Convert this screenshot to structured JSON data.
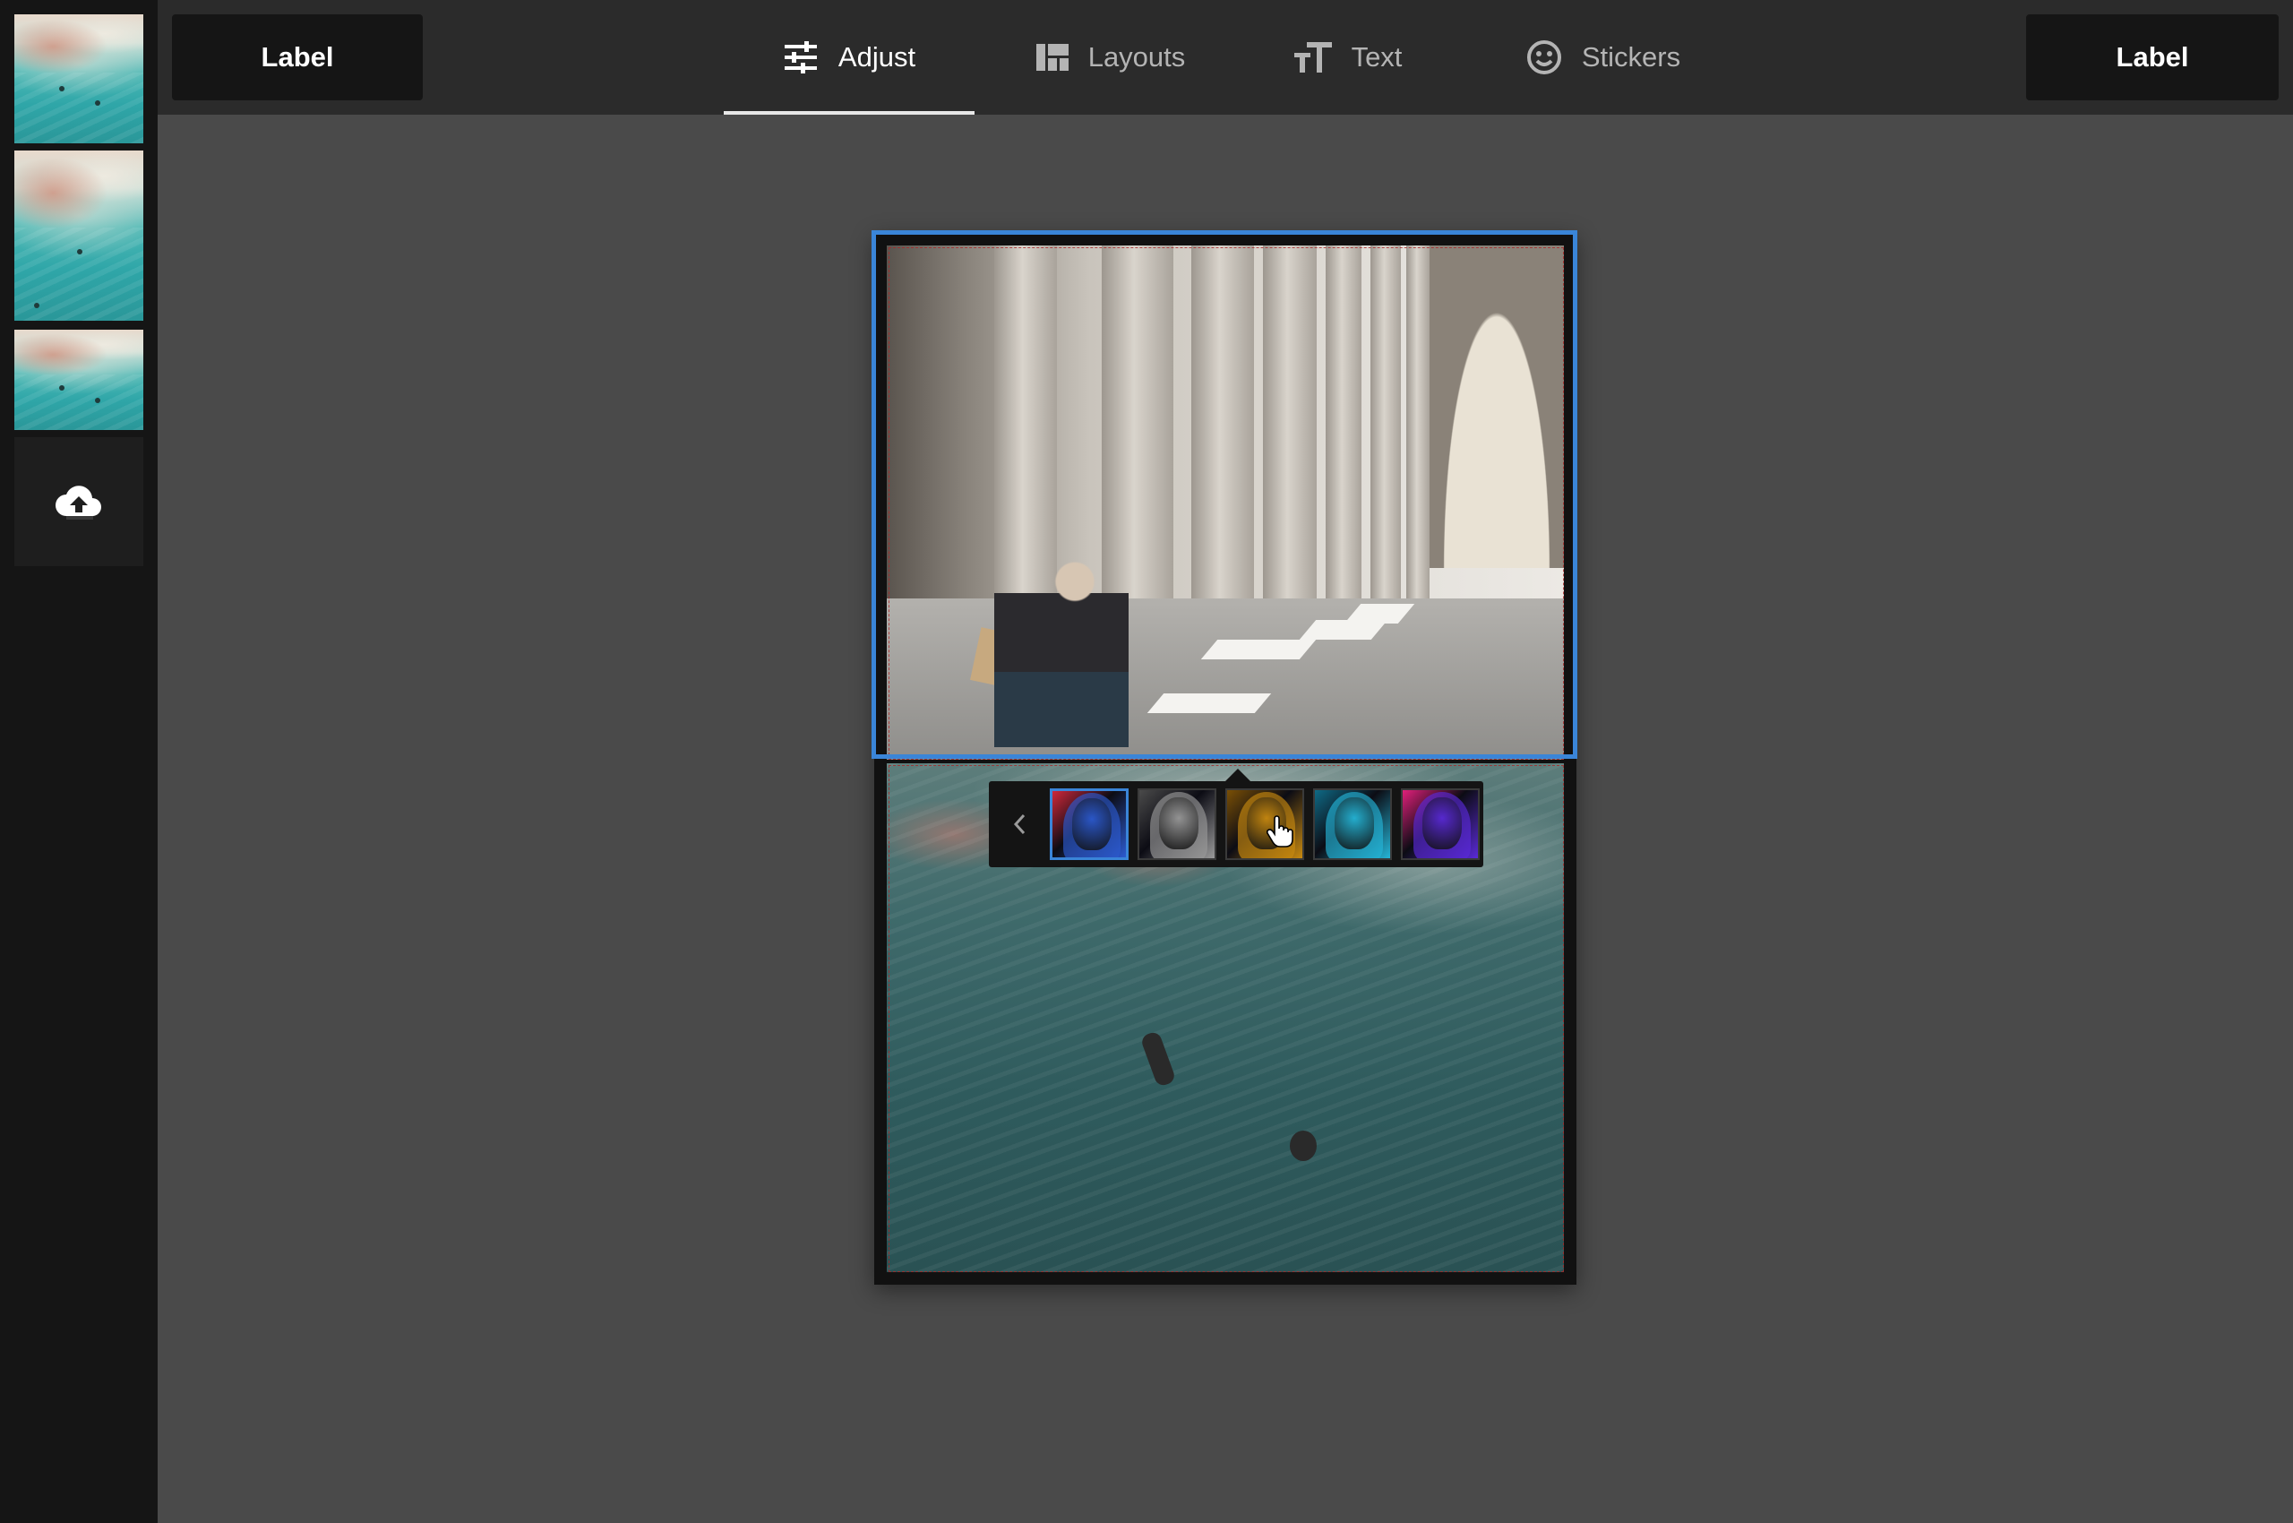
{
  "toolbar": {
    "left_label": "Label",
    "right_label": "Label",
    "tabs": [
      {
        "label": "Adjust",
        "icon": "sliders-icon",
        "active": true
      },
      {
        "label": "Layouts",
        "icon": "layout-icon",
        "active": false
      },
      {
        "label": "Text",
        "icon": "text-size-icon",
        "active": false
      },
      {
        "label": "Stickers",
        "icon": "smiley-icon",
        "active": false
      }
    ]
  },
  "sidebar": {
    "thumbnails": [
      "ocean-aerial-thumbnail",
      "ocean-aerial-thumbnail",
      "ocean-aerial-thumbnail"
    ],
    "upload_icon": "cloud-upload-icon"
  },
  "collage": {
    "panels": [
      "arcade-man-reading-photo",
      "ocean-aerial-photo"
    ],
    "selected_panel": 1
  },
  "filters": {
    "nav_icon": "chevron-left-icon",
    "selected_index": 0,
    "items": [
      {
        "name": "blue-red",
        "colors": [
          "#2c5ad0",
          "#d0283a"
        ]
      },
      {
        "name": "mono",
        "colors": [
          "#9a9a9a",
          "#4a4a4a"
        ]
      },
      {
        "name": "amber",
        "colors": [
          "#c98a10",
          "#7a4f05"
        ]
      },
      {
        "name": "cyan",
        "colors": [
          "#25b6d8",
          "#0f6a86"
        ]
      },
      {
        "name": "violet-magenta",
        "colors": [
          "#5a2ad8",
          "#e0207a"
        ]
      }
    ]
  },
  "colors": {
    "accent": "#3a85d8",
    "topbar": "#2b2b2b",
    "sidebar": "#151515",
    "workspace": "#4a4a4a"
  }
}
